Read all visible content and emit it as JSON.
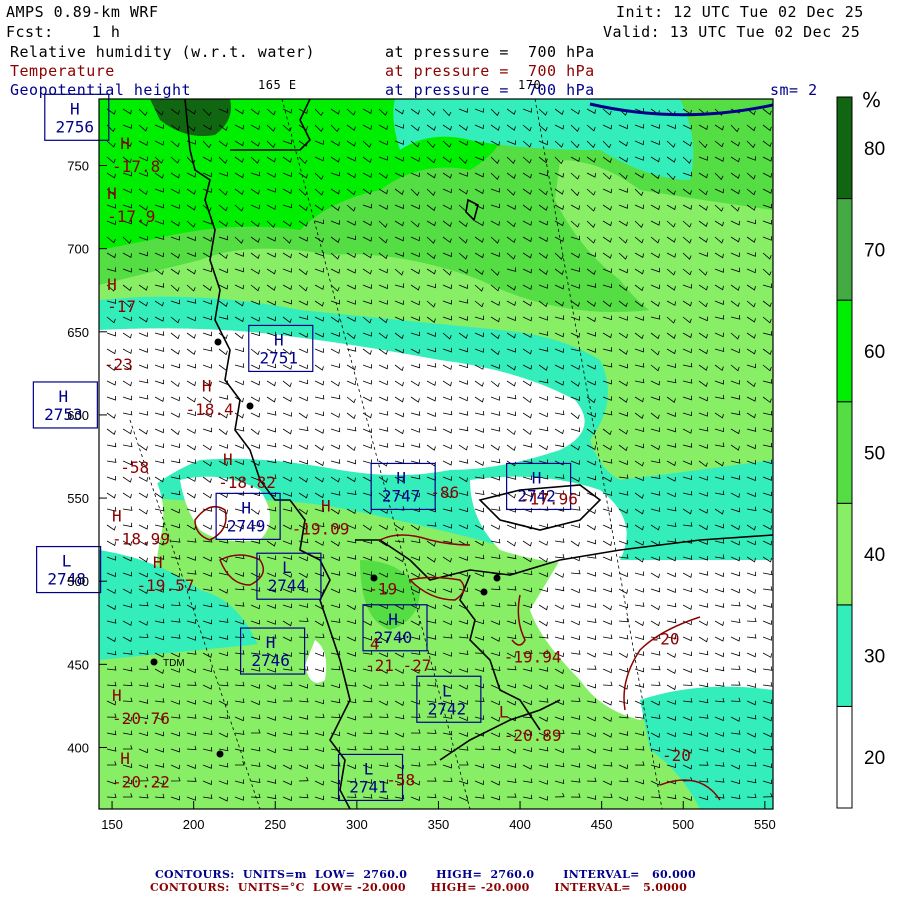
{
  "header": {
    "model": "AMPS 0.89-km WRF",
    "init": "Init: 12 UTC Tue 02 Dec 25",
    "fcst": "Fcst:    1 h",
    "valid": "Valid: 13 UTC Tue 02 Dec 25",
    "field1": "Relative humidity (w.r.t. water)",
    "field1_level": "at pressure =  700 hPa",
    "field2": "Temperature",
    "field2_level": "at pressure =  700 hPa",
    "field3": "Geopotential height",
    "field3_level": "at pressure =  700 hPa",
    "smooth": "sm= 2",
    "lon_label_165": "165 E",
    "lon_label_170": "170"
  },
  "colorbar": {
    "unit": "%",
    "ticks": [
      "20",
      "30",
      "40",
      "50",
      "60",
      "70",
      "80"
    ],
    "colors": [
      "#ffffff",
      "#33eebb",
      "#88ee66",
      "#55dd44",
      "#00ee00",
      "#44aa44",
      "#116611"
    ]
  },
  "axes": {
    "x_ticks": [
      "150",
      "200",
      "250",
      "300",
      "350",
      "400",
      "450",
      "500",
      "550"
    ],
    "y_ticks": [
      "400",
      "450",
      "500",
      "550",
      "600",
      "650",
      "700",
      "750"
    ],
    "x_range": [
      142,
      555
    ],
    "y_range": [
      363,
      790
    ]
  },
  "height_labels": [
    {
      "type": "H",
      "value": "2756",
      "x": 110,
      "y": 782
    },
    {
      "type": "H",
      "value": "2751",
      "x": 235,
      "y": 643
    },
    {
      "type": "H",
      "value": "2753",
      "x": 103,
      "y": 609
    },
    {
      "type": "H",
      "value": "2747",
      "x": 310,
      "y": 560
    },
    {
      "type": "H",
      "value": "2742",
      "x": 393,
      "y": 560
    },
    {
      "type": "H",
      "value": "2749",
      "x": 215,
      "y": 542
    },
    {
      "type": "L",
      "value": "2748",
      "x": 105,
      "y": 510
    },
    {
      "type": "L",
      "value": "2744",
      "x": 240,
      "y": 506
    },
    {
      "type": "H",
      "value": "2740",
      "x": 305,
      "y": 475
    },
    {
      "type": "H",
      "value": "2746",
      "x": 230,
      "y": 461
    },
    {
      "type": "L",
      "value": "2742",
      "x": 338,
      "y": 432
    },
    {
      "type": "L",
      "value": "2741",
      "x": 290,
      "y": 385
    }
  ],
  "temp_labels": [
    {
      "text": "H",
      "x": 155,
      "y": 760
    },
    {
      "text": "-17.8",
      "x": 150,
      "y": 746
    },
    {
      "text": "H",
      "x": 147,
      "y": 730
    },
    {
      "text": "-17.9",
      "x": 147,
      "y": 716
    },
    {
      "text": "H",
      "x": 147,
      "y": 675
    },
    {
      "text": "-17",
      "x": 147,
      "y": 662
    },
    {
      "text": "-23",
      "x": 145,
      "y": 627
    },
    {
      "text": "H",
      "x": 205,
      "y": 614
    },
    {
      "text": "-18.4",
      "x": 195,
      "y": 600
    },
    {
      "text": "H",
      "x": 218,
      "y": 570
    },
    {
      "text": "-18.82",
      "x": 215,
      "y": 556
    },
    {
      "text": "-58",
      "x": 155,
      "y": 565
    },
    {
      "text": "H",
      "x": 278,
      "y": 542
    },
    {
      "text": "-19.09",
      "x": 260,
      "y": 528
    },
    {
      "text": "H",
      "x": 150,
      "y": 536
    },
    {
      "text": "-18.99",
      "x": 150,
      "y": 522
    },
    {
      "text": "H",
      "x": 175,
      "y": 508
    },
    {
      "text": "-19.57",
      "x": 165,
      "y": 494
    },
    {
      "text": "-19",
      "x": 307,
      "y": 492
    },
    {
      "text": "4",
      "x": 308,
      "y": 459
    },
    {
      "text": "-21",
      "x": 305,
      "y": 446
    },
    {
      "text": "-27",
      "x": 328,
      "y": 446
    },
    {
      "text": "-19.94",
      "x": 390,
      "y": 451
    },
    {
      "text": "-86",
      "x": 345,
      "y": 550
    },
    {
      "text": "-17.96",
      "x": 400,
      "y": 546
    },
    {
      "text": "H",
      "x": 150,
      "y": 428
    },
    {
      "text": "-20.76",
      "x": 150,
      "y": 414
    },
    {
      "text": "L",
      "x": 387,
      "y": 418
    },
    {
      "text": "-20.89",
      "x": 390,
      "y": 404
    },
    {
      "text": "H",
      "x": 155,
      "y": 390
    },
    {
      "text": "-20.22",
      "x": 150,
      "y": 376
    },
    {
      "text": "-58",
      "x": 318,
      "y": 377
    },
    {
      "text": "-20",
      "x": 480,
      "y": 462
    },
    {
      "text": "-20",
      "x": 487,
      "y": 392
    }
  ],
  "station_labels": [
    {
      "text": "TDM",
      "x": 185,
      "y": 452
    }
  ],
  "footer": {
    "line1": "CONTOURS:  UNITS=m  LOW=  2760.0       HIGH=  2760.0       INTERVAL=   60.000",
    "line2": "CONTOURS:  UNITS=°C  LOW= -20.000      HIGH= -20.000      INTERVAL=   5.0000"
  }
}
